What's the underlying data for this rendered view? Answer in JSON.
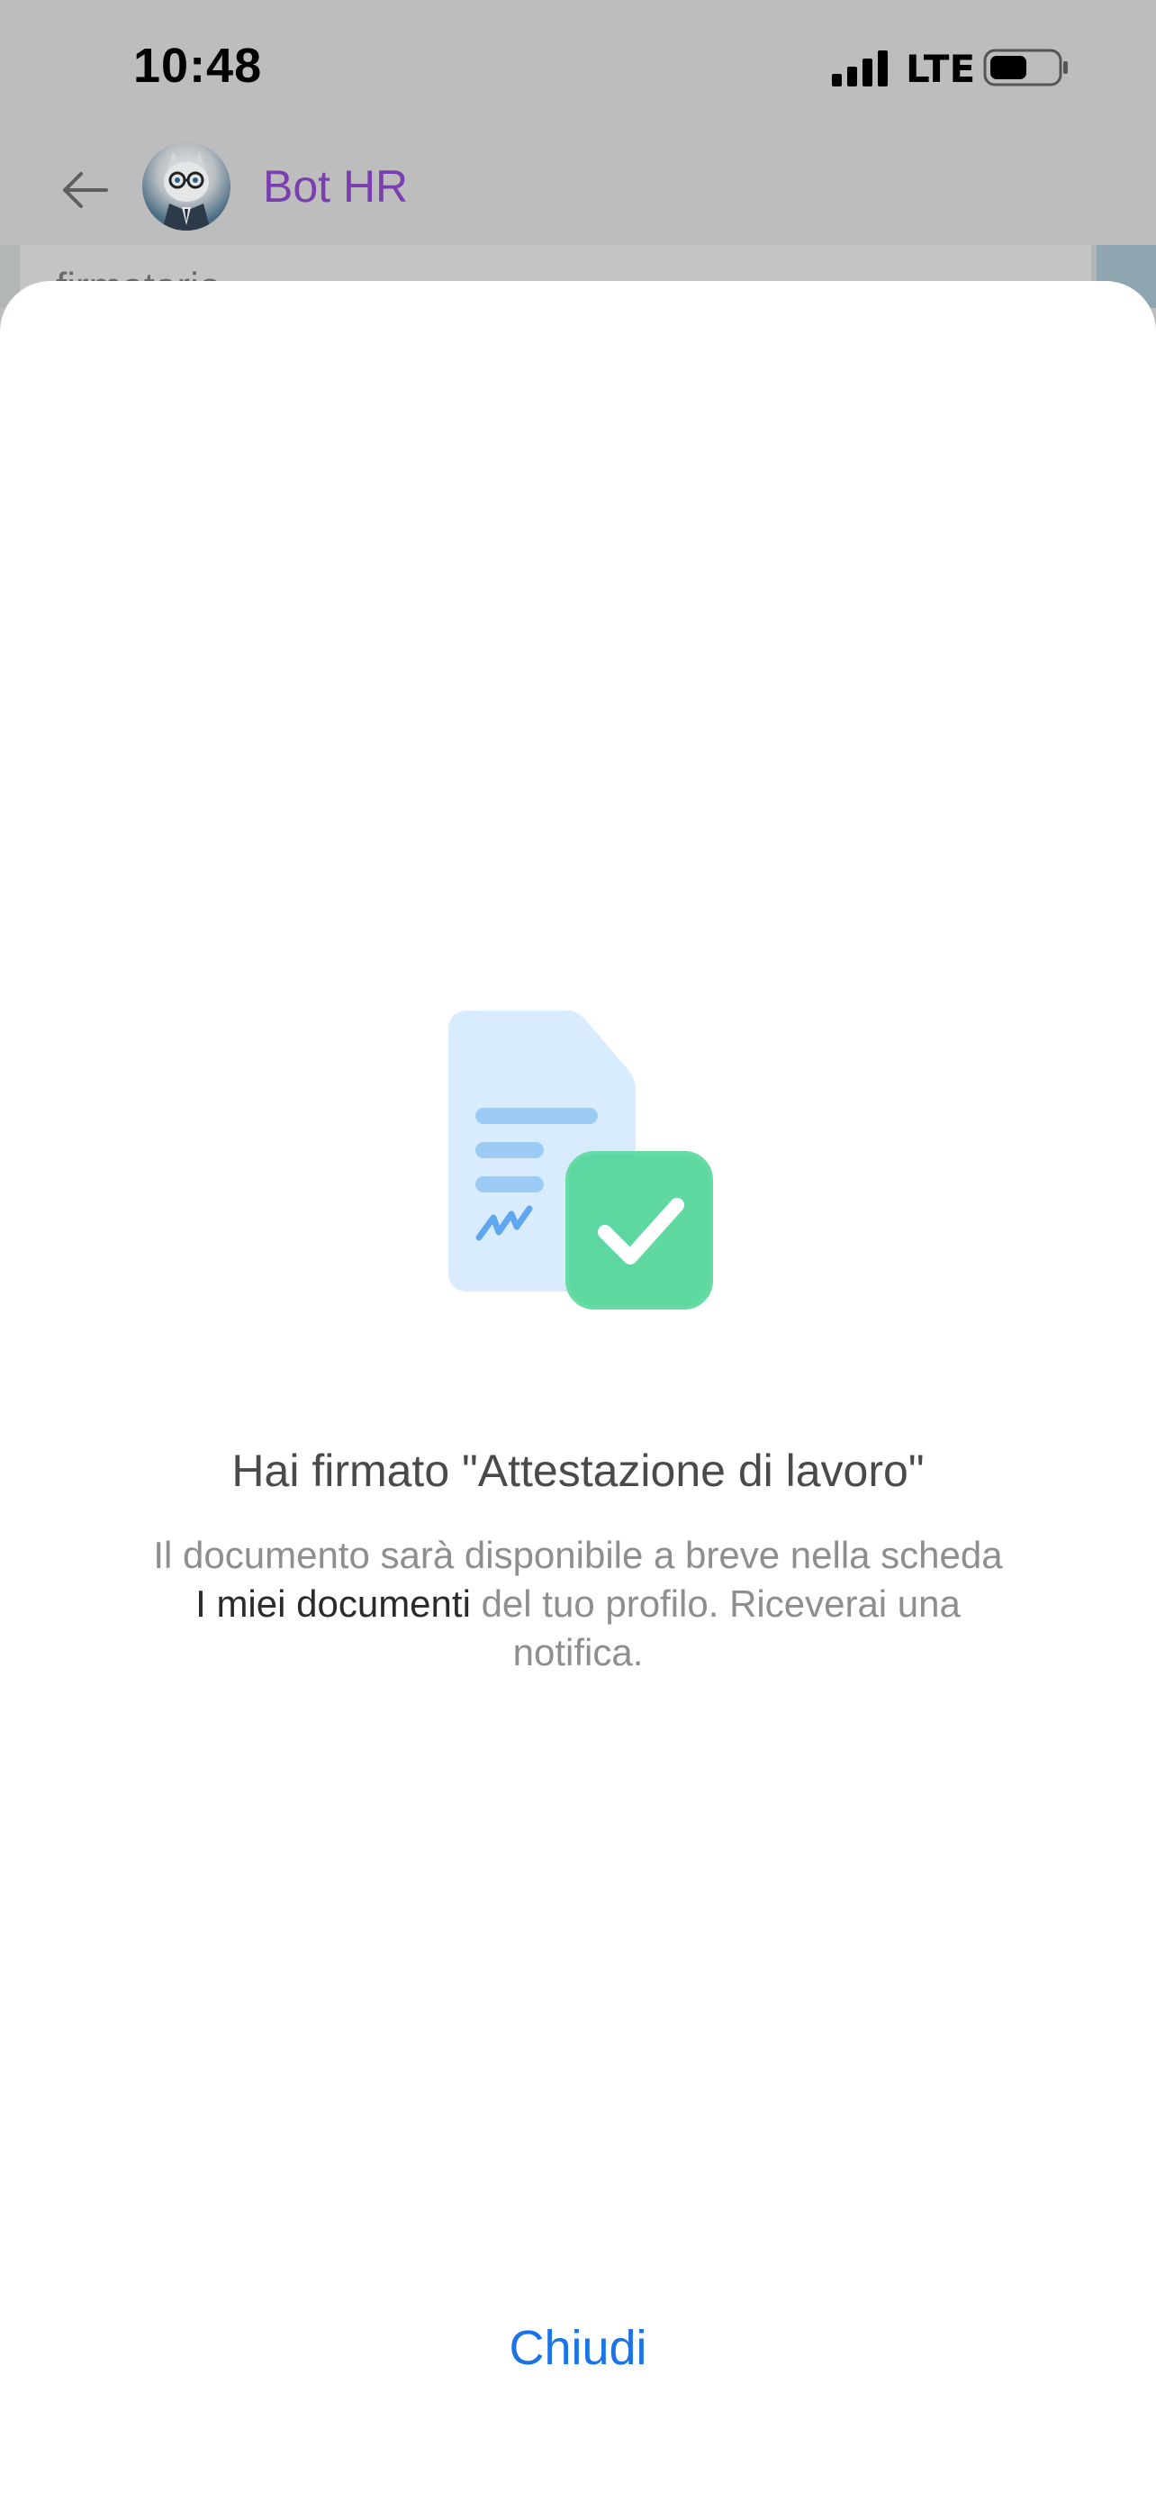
{
  "status_bar": {
    "time": "10:48",
    "network": "LTE",
    "signal_icon": "signal-bars-icon",
    "battery_icon": "battery-icon"
  },
  "chat_header": {
    "back_icon": "back-arrow-icon",
    "avatar_icon": "bot-avatar-cat-icon",
    "title": "Bot HR",
    "title_color": "#7a3fae"
  },
  "chat_backdrop": {
    "peek_text": "firmatario"
  },
  "sheet": {
    "illustration_icon": "signed-document-check-icon",
    "title": "Hai firmato \"Attestazione di lavoro\"",
    "message_part1": "Il documento sarà disponibile a breve nella scheda ",
    "message_link": "I miei documenti",
    "message_part2": " del tuo profilo. Riceverai una notifica.",
    "close_label": "Chiudi",
    "accent_color": "#1a73e8",
    "check_color": "#4fd597",
    "document_color": "#d9ecfd"
  }
}
